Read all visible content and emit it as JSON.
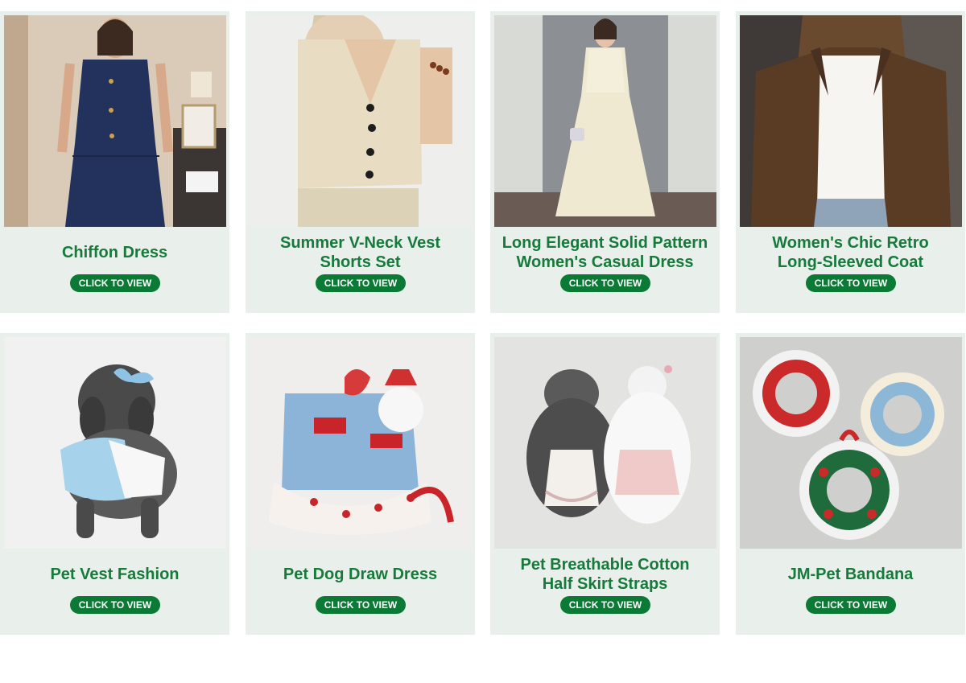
{
  "colors": {
    "card_bg": "#e9efeb",
    "title": "#167a3a",
    "button_bg": "#0a7a34",
    "button_text": "#ffffff"
  },
  "products": [
    {
      "line1": "Chiffon Dress",
      "line2": "",
      "cta": "CLICK TO VIEW",
      "image": "woman-navy-sleeveless-dress"
    },
    {
      "line1": "Summer V-Neck Vest",
      "line2": "Shorts Set",
      "cta": "CLICK TO VIEW",
      "image": "woman-beige-vest"
    },
    {
      "line1": "Long Elegant Solid Pattern",
      "line2": "Women's Casual Dress",
      "cta": "CLICK TO VIEW",
      "image": "woman-cream-long-dress"
    },
    {
      "line1": "Women's Chic Retro",
      "line2": "Long-Sleeved Coat",
      "cta": "CLICK TO VIEW",
      "image": "woman-brown-coat"
    },
    {
      "line1": "Pet Vest Fashion",
      "line2": "",
      "cta": "CLICK TO VIEW",
      "image": "poodle-blue-vest"
    },
    {
      "line1": "Pet Dog Draw Dress",
      "line2": "",
      "cta": "CLICK TO VIEW",
      "image": "denim-heart-dog-dress"
    },
    {
      "line1": "Pet Breathable Cotton",
      "line2": "Half Skirt Straps",
      "cta": "CLICK TO VIEW",
      "image": "two-dogs-skirts"
    },
    {
      "line1": "JM-Pet Bandana",
      "line2": "",
      "cta": "CLICK TO VIEW",
      "image": "crochet-wreath-collars"
    }
  ]
}
